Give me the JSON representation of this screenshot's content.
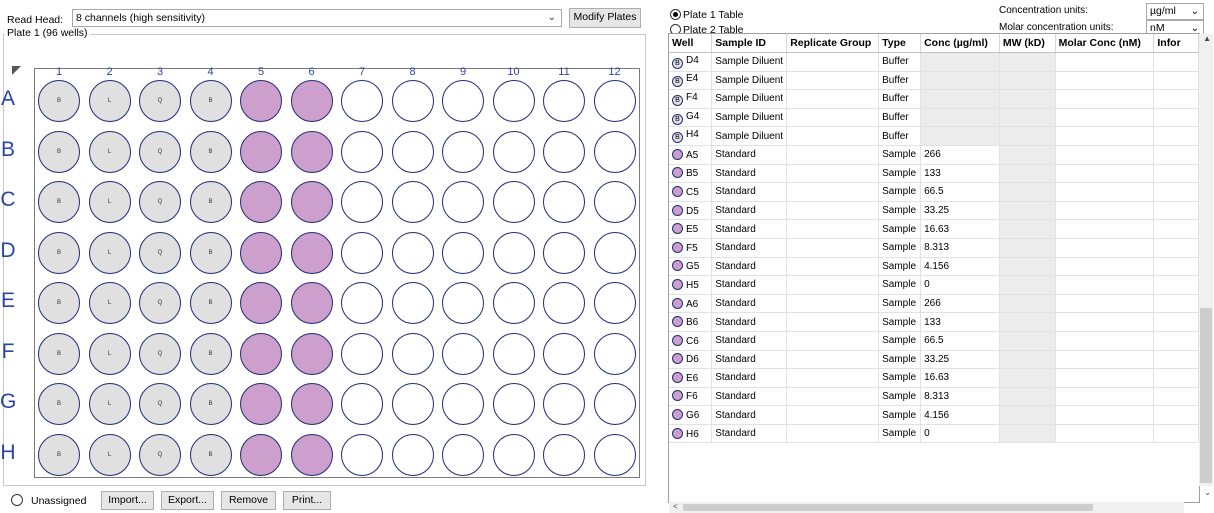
{
  "read_head": {
    "label": "Read Head:",
    "value": "8 channels (high sensitivity)"
  },
  "modify_plates_label": "Modify Plates",
  "plate_group_title": "Plate 1 (96 wells)",
  "columns": [
    "1",
    "2",
    "3",
    "4",
    "5",
    "6",
    "7",
    "8",
    "9",
    "10",
    "11",
    "12"
  ],
  "rows": [
    "A",
    "B",
    "C",
    "D",
    "E",
    "F",
    "G",
    "H"
  ],
  "well_labels": {
    "col1": "B",
    "col2": "L",
    "col3": "Q",
    "col4": "B"
  },
  "legend": {
    "unassigned": "Unassigned"
  },
  "bottom_buttons": {
    "import": "Import...",
    "export": "Export...",
    "remove": "Remove",
    "print": "Print..."
  },
  "table_radios": {
    "plate1": "Plate 1 Table",
    "plate2": "Plate 2 Table"
  },
  "units": {
    "concentration_label": "Concentration units:",
    "concentration_value": "µg/ml",
    "molar_label": "Molar concentration units:",
    "molar_value": "nM"
  },
  "table_headers": [
    "Well",
    "Sample ID",
    "Replicate Group",
    "Type",
    "Conc (µg/ml)",
    "MW (kD)",
    "Molar Conc (nM)",
    "Infor"
  ],
  "table_rows": [
    {
      "kind": "buffer",
      "well": "D4",
      "sample": "Sample Diluent",
      "type": "Buffer",
      "conc": ""
    },
    {
      "kind": "buffer",
      "well": "E4",
      "sample": "Sample Diluent",
      "type": "Buffer",
      "conc": ""
    },
    {
      "kind": "buffer",
      "well": "F4",
      "sample": "Sample Diluent",
      "type": "Buffer",
      "conc": ""
    },
    {
      "kind": "buffer",
      "well": "G4",
      "sample": "Sample Diluent",
      "type": "Buffer",
      "conc": ""
    },
    {
      "kind": "buffer",
      "well": "H4",
      "sample": "Sample Diluent",
      "type": "Buffer",
      "conc": ""
    },
    {
      "kind": "sample",
      "well": "A5",
      "sample": "Standard",
      "type": "Sample",
      "conc": "266"
    },
    {
      "kind": "sample",
      "well": "B5",
      "sample": "Standard",
      "type": "Sample",
      "conc": "133"
    },
    {
      "kind": "sample",
      "well": "C5",
      "sample": "Standard",
      "type": "Sample",
      "conc": "66.5"
    },
    {
      "kind": "sample",
      "well": "D5",
      "sample": "Standard",
      "type": "Sample",
      "conc": "33.25"
    },
    {
      "kind": "sample",
      "well": "E5",
      "sample": "Standard",
      "type": "Sample",
      "conc": "16.63"
    },
    {
      "kind": "sample",
      "well": "F5",
      "sample": "Standard",
      "type": "Sample",
      "conc": "8.313"
    },
    {
      "kind": "sample",
      "well": "G5",
      "sample": "Standard",
      "type": "Sample",
      "conc": "4.156"
    },
    {
      "kind": "sample",
      "well": "H5",
      "sample": "Standard",
      "type": "Sample",
      "conc": "0"
    },
    {
      "kind": "sample",
      "well": "A6",
      "sample": "Standard",
      "type": "Sample",
      "conc": "266"
    },
    {
      "kind": "sample",
      "well": "B6",
      "sample": "Standard",
      "type": "Sample",
      "conc": "133"
    },
    {
      "kind": "sample",
      "well": "C6",
      "sample": "Standard",
      "type": "Sample",
      "conc": "66.5"
    },
    {
      "kind": "sample",
      "well": "D6",
      "sample": "Standard",
      "type": "Sample",
      "conc": "33.25"
    },
    {
      "kind": "sample",
      "well": "E6",
      "sample": "Standard",
      "type": "Sample",
      "conc": "16.63"
    },
    {
      "kind": "sample",
      "well": "F6",
      "sample": "Standard",
      "type": "Sample",
      "conc": "8.313"
    },
    {
      "kind": "sample",
      "well": "G6",
      "sample": "Standard",
      "type": "Sample",
      "conc": "4.156"
    },
    {
      "kind": "sample",
      "well": "H6",
      "sample": "Standard",
      "type": "Sample",
      "conc": "0"
    }
  ],
  "buffer_badge": "B",
  "colors": {
    "sample": "#cc9fcc",
    "buffer": "#e0e0e0",
    "well_border": "#1f2c78",
    "header_text": "#2a44a8"
  }
}
